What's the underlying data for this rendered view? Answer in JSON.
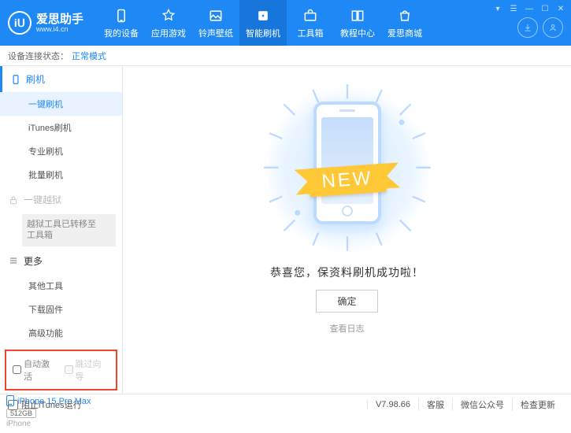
{
  "header": {
    "title": "爱思助手",
    "url": "www.i4.cn",
    "nav": [
      {
        "label": "我的设备"
      },
      {
        "label": "应用游戏"
      },
      {
        "label": "铃声壁纸"
      },
      {
        "label": "智能刷机"
      },
      {
        "label": "工具箱"
      },
      {
        "label": "教程中心"
      },
      {
        "label": "爱思商城"
      }
    ]
  },
  "status": {
    "label": "设备连接状态：",
    "value": "正常模式"
  },
  "sidebar": {
    "flash_title": "刷机",
    "flash_items": [
      "一键刷机",
      "iTunes刷机",
      "专业刷机",
      "批量刷机"
    ],
    "jailbreak_title": "一键越狱",
    "jailbreak_note": "越狱工具已转移至\n工具箱",
    "more_title": "更多",
    "more_items": [
      "其他工具",
      "下载固件",
      "高级功能"
    ],
    "check_auto": "自动激活",
    "check_skip": "跳过向导"
  },
  "device": {
    "name": "iPhone 15 Pro Max",
    "storage": "512GB",
    "type": "iPhone"
  },
  "content": {
    "ribbon": "NEW",
    "message": "恭喜您，保资料刷机成功啦！",
    "ok": "确定",
    "log": "查看日志"
  },
  "footer": {
    "block_itunes": "阻止iTunes运行",
    "version": "V7.98.66",
    "service": "客服",
    "wechat": "微信公众号",
    "update": "检查更新"
  }
}
